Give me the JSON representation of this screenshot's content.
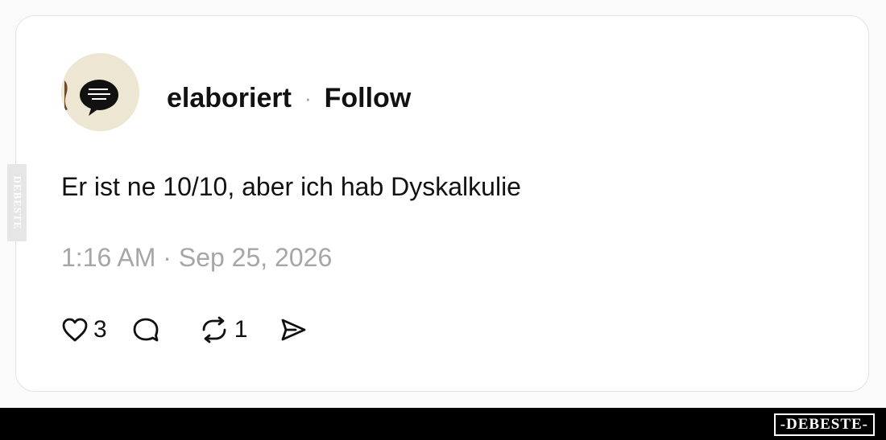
{
  "watermark": {
    "side_text": "DEBESTE",
    "badge_text": "-DEBESTE-"
  },
  "post": {
    "username": "elaboriert",
    "separator": "·",
    "follow_label": "Follow",
    "text": "Er ist ne 10/10, aber ich hab Dyskalkulie",
    "timestamp": "1:16 AM · Sep 25, 2026"
  },
  "actions": {
    "likes": "3",
    "replies": "",
    "reposts": "1",
    "share": ""
  },
  "icons": {
    "like": "heart-icon",
    "reply": "comment-icon",
    "repost": "repost-icon",
    "share": "share-icon"
  },
  "colors": {
    "text": "#111111",
    "muted": "#a6a6a6",
    "border": "#e3e3e3",
    "bar": "#000000"
  }
}
